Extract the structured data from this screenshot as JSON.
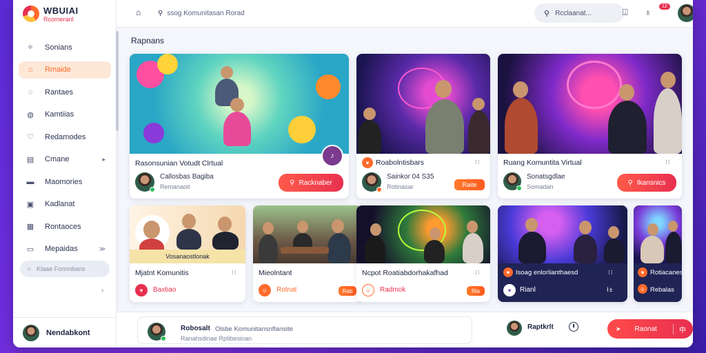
{
  "app": {
    "logo_title": "WBUIAI",
    "logo_subtitle": "Rcomeranl"
  },
  "topbar": {
    "url_text": "ssog Komunitasan Rorad",
    "search_text": "Rcclaanat...",
    "notification_badge": "12"
  },
  "sidebar": {
    "items": [
      {
        "label": "Sonians",
        "icon": "compass-icon"
      },
      {
        "label": "Rmaide",
        "icon": "home-icon",
        "active": true
      },
      {
        "label": "Rantaes",
        "icon": "chat-icon"
      },
      {
        "label": "Kamtiias",
        "icon": "bell-icon"
      },
      {
        "label": "Redamodes",
        "icon": "heart-icon"
      },
      {
        "label": "Cmane",
        "icon": "document-icon",
        "chevron": "▸"
      },
      {
        "label": "Maomories",
        "icon": "folder-icon"
      },
      {
        "label": "Kadlanat",
        "icon": "calendar-icon"
      },
      {
        "label": "Rontaoces",
        "icon": "grid-icon"
      },
      {
        "label": "Mepaidas",
        "icon": "message-icon",
        "chevron": "≫"
      }
    ],
    "search_placeholder": "Klaae Fonnnbans",
    "collapse_chevron": "›",
    "user_name": "Nendabkont"
  },
  "main": {
    "section_title": "Rapnans",
    "cards": [
      {
        "title": "Rasonsunian Votudt Clrtual",
        "user_name": "Callosbas Bagiba",
        "user_sub": "Remanaoit",
        "button": "Racknaber",
        "dots": "⁝⁝"
      },
      {
        "title": "Roabolntisbars",
        "user_name": "Sainkor 04 S35",
        "user_sub": "Rotinasar",
        "button": "Raite",
        "dots": "⁝⁝"
      },
      {
        "title": "Ruang Komuntita Virtual",
        "user_name": "Sonatsgdlae",
        "user_sub": "Somadan",
        "button": "Ikansnics",
        "dots": "⁝⁝"
      },
      {
        "title": "Mjatnt Komunitis",
        "caption": "Vosanaostlonak",
        "user_name": "Baxtiao",
        "dots": "⁝⁝"
      },
      {
        "title": "Mieolntant",
        "user_name": "Rotnat",
        "button": "Rab",
        "dots": "⁝"
      },
      {
        "title": "Ncpot Roatiabdorhakafhad",
        "user_name": "Radmok",
        "button": "Rla",
        "dots": "⁝⁝"
      },
      {
        "title": "Isoag enlorlianthaesd",
        "user_name": "Rianl",
        "dots": "Ⅰ±"
      },
      {
        "title": "Rotiacanes",
        "user_name": "Rebalas"
      }
    ]
  },
  "bottombar": {
    "comment_name": "Robosalt",
    "comment_msg": "Olsbe Komunitansnflansite",
    "comment_sub": "Ranahsdinae Rptibesinan",
    "user_name": "Raptkrlt",
    "cta_label": "Raonat",
    "cta_left": "➤",
    "cta_right": "中"
  },
  "colors": {
    "accent": "#ff6a2b",
    "primary_red": "#e8304f",
    "background_purple": "#5b2bd6"
  }
}
